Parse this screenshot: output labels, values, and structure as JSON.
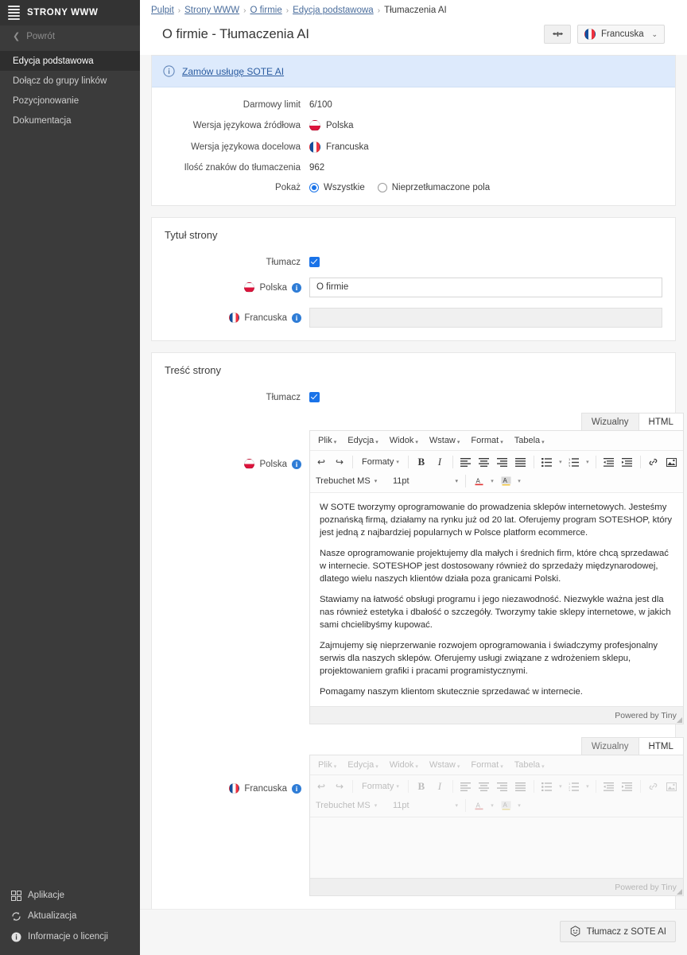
{
  "sidebar": {
    "brand": "STRONY WWW",
    "back_label": "Powrót",
    "items": [
      {
        "label": "Edycja podstawowa"
      },
      {
        "label": "Dołącz do grupy linków"
      },
      {
        "label": "Pozycjonowanie"
      },
      {
        "label": "Dokumentacja"
      }
    ],
    "footer": [
      {
        "label": "Aplikacje",
        "icon": "grid-icon"
      },
      {
        "label": "Aktualizacja",
        "icon": "refresh-icon"
      },
      {
        "label": "Informacje o licencji",
        "icon": "info-icon"
      }
    ]
  },
  "breadcrumb": {
    "items": [
      "Pulpit",
      "Strony WWW",
      "O firmie",
      "Edycja podstawowa"
    ],
    "current": "Tłumaczenia AI",
    "separator": "›"
  },
  "header": {
    "title": "O firmie - Tłumaczenia AI",
    "swap_icon": "swap-horizontal-icon",
    "language_selected": "Francuska",
    "caret": "⌄"
  },
  "notice": {
    "icon": "info-circle-icon",
    "link": "Zamów usługę SOTE AI"
  },
  "summary": {
    "rows": [
      {
        "label": "Darmowy limit",
        "value": "6/100",
        "flag": ""
      },
      {
        "label": "Wersja językowa źródłowa",
        "value": "Polska",
        "flag": "pl"
      },
      {
        "label": "Wersja językowa docelowa",
        "value": "Francuska",
        "flag": "fr"
      },
      {
        "label": "Ilość znaków do tłumaczenia",
        "value": "962",
        "flag": ""
      }
    ],
    "show_label": "Pokaż",
    "radios": [
      {
        "label": "Wszystkie",
        "selected": true
      },
      {
        "label": "Nieprzetłumaczone pola",
        "selected": false
      }
    ]
  },
  "title_section": {
    "heading": "Tytuł strony",
    "translate_label": "Tłumacz",
    "translate_checked": true,
    "source_lang": "Polska",
    "target_lang": "Francuska",
    "source_value": "O firmie",
    "target_value": ""
  },
  "content_section": {
    "heading": "Treść strony",
    "translate_label": "Tłumacz",
    "translate_checked": true,
    "source_lang": "Polska",
    "target_lang": "Francuska"
  },
  "editor": {
    "tabs": {
      "visual": "Wizualny",
      "html": "HTML"
    },
    "menus": [
      "Plik",
      "Edycja",
      "Widok",
      "Wstaw",
      "Format",
      "Tabela"
    ],
    "formats_label": "Formaty",
    "font_family": "Trebuchet MS",
    "font_size": "11pt",
    "status": "Powered by Tiny",
    "icons": {
      "undo": "undo-icon",
      "redo": "redo-icon",
      "bold": "bold-icon",
      "italic": "italic-icon",
      "align_left": "align-left-icon",
      "align_center": "align-center-icon",
      "align_right": "align-right-icon",
      "align_justify": "align-justify-icon",
      "bullet_list": "bullet-list-icon",
      "numbered_list": "numbered-list-icon",
      "outdent": "outdent-icon",
      "indent": "indent-icon",
      "link": "link-icon",
      "image": "image-icon",
      "text_color": "text-color-icon",
      "background_color": "background-color-icon"
    },
    "paragraphs_pl": [
      "W SOTE tworzymy oprogramowanie do prowadzenia sklepów internetowych. Jesteśmy poznańską firmą, działamy na rynku już od 20 lat. Oferujemy program SOTESHOP, który jest jedną z najbardziej popularnych w Polsce platform ecommerce.",
      "Nasze oprogramowanie projektujemy dla małych i średnich firm, które chcą sprzedawać w internecie. SOTESHOP jest dostosowany również do sprzedaży międzynarodowej, dlatego wielu naszych klientów działa poza granicami Polski.",
      "Stawiamy na łatwość obsługi programu i jego niezawodność. Niezwykle ważna jest dla nas również estetyka i dbałość o szczegóły. Tworzymy takie sklepy internetowe, w jakich sami chcielibyśmy kupować.",
      "Zajmujemy się nieprzerwanie rozwojem oprogramowania i świadczymy profesjonalny serwis dla naszych sklepów. Oferujemy usługi związane z wdrożeniem sklepu, projektowaniem grafiki i pracami programistycznymi.",
      "Pomagamy naszym klientom skutecznie sprzedawać w internecie."
    ]
  },
  "footer": {
    "translate_button": "Tłumacz z SOTE AI",
    "translate_icon": "sote-ai-robot-icon"
  },
  "colors": {
    "sidebar_bg": "#3b3b3b",
    "sidebar_active": "#2e2e2e",
    "notice_bg": "#ddeafc",
    "accent_blue": "#1a73e8",
    "link_blue": "#2b5ca0"
  }
}
